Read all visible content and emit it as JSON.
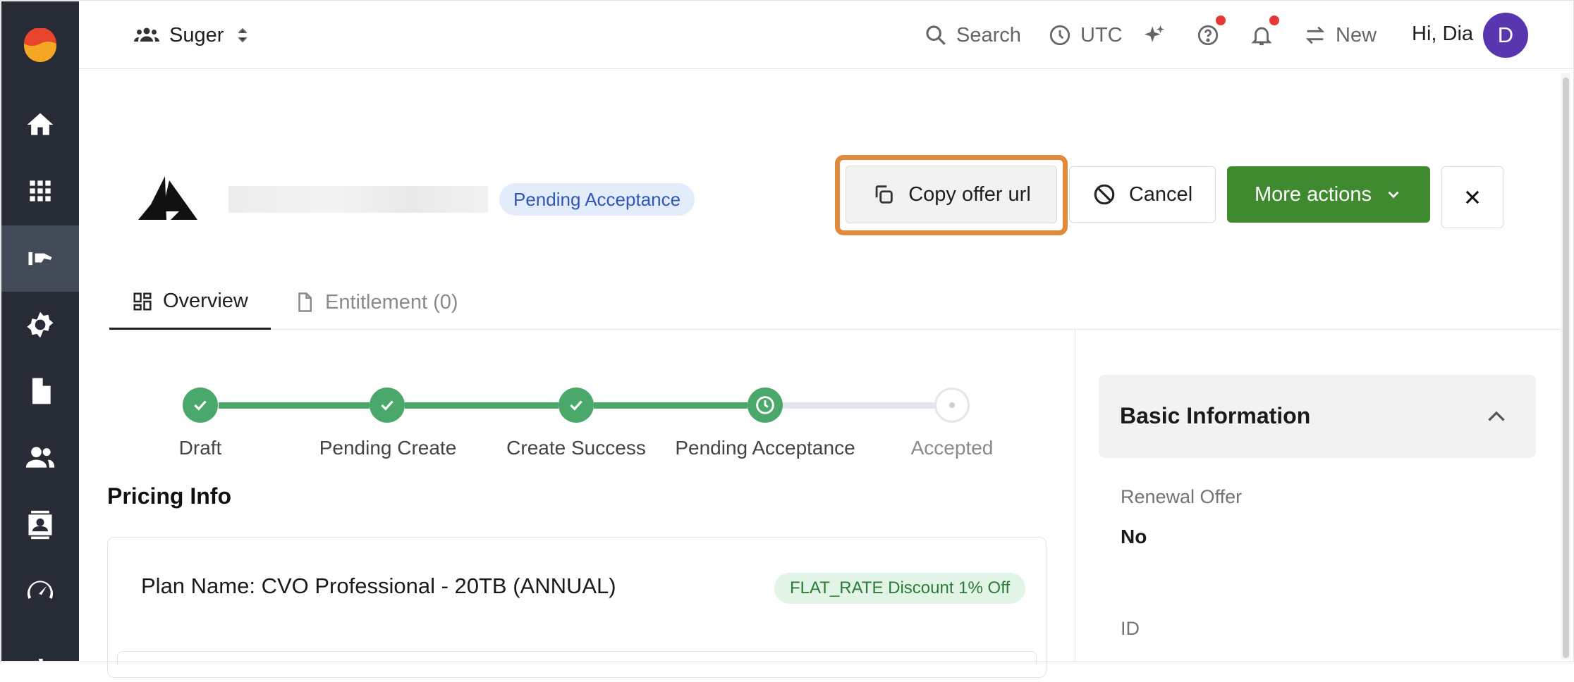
{
  "topbar": {
    "org_name": "Suger",
    "search_label": "Search",
    "timezone_label": "UTC",
    "new_label": "New",
    "greeting": "Hi, Dia",
    "avatar_initial": "D"
  },
  "sidebar": {
    "items": [
      {
        "icon": "home-icon"
      },
      {
        "icon": "apps-grid-icon"
      },
      {
        "icon": "offers-icon",
        "active": true
      },
      {
        "icon": "settings-gear-icon"
      },
      {
        "icon": "document-icon"
      },
      {
        "icon": "people-icon"
      },
      {
        "icon": "contacts-icon"
      },
      {
        "icon": "speedometer-icon"
      },
      {
        "icon": "bar-chart-icon"
      }
    ]
  },
  "header": {
    "status": "Pending Acceptance",
    "copy_url_label": "Copy offer url",
    "cancel_label": "Cancel",
    "more_actions_label": "More actions"
  },
  "tabs": [
    {
      "label": "Overview",
      "active": true
    },
    {
      "label": "Entitlement (0)",
      "active": false
    }
  ],
  "stepper": {
    "steps": [
      {
        "label": "Draft",
        "state": "done"
      },
      {
        "label": "Pending Create",
        "state": "done"
      },
      {
        "label": "Create Success",
        "state": "done"
      },
      {
        "label": "Pending Acceptance",
        "state": "current"
      },
      {
        "label": "Accepted",
        "state": "pending"
      }
    ]
  },
  "pricing": {
    "title": "Pricing Info",
    "plan_name": "Plan Name: CVO Professional - 20TB (ANNUAL)",
    "discount": "FLAT_RATE Discount 1% Off"
  },
  "basic_info": {
    "title": "Basic Information",
    "fields": [
      {
        "label": "Renewal Offer",
        "value": "No"
      },
      {
        "label": "ID",
        "value": ""
      }
    ]
  },
  "colors": {
    "sidebar_bg": "#262b36",
    "primary_green": "#3f8a2f",
    "step_green": "#4aa86a",
    "highlight_orange": "#e08a3c",
    "avatar_purple": "#5a35b0"
  }
}
